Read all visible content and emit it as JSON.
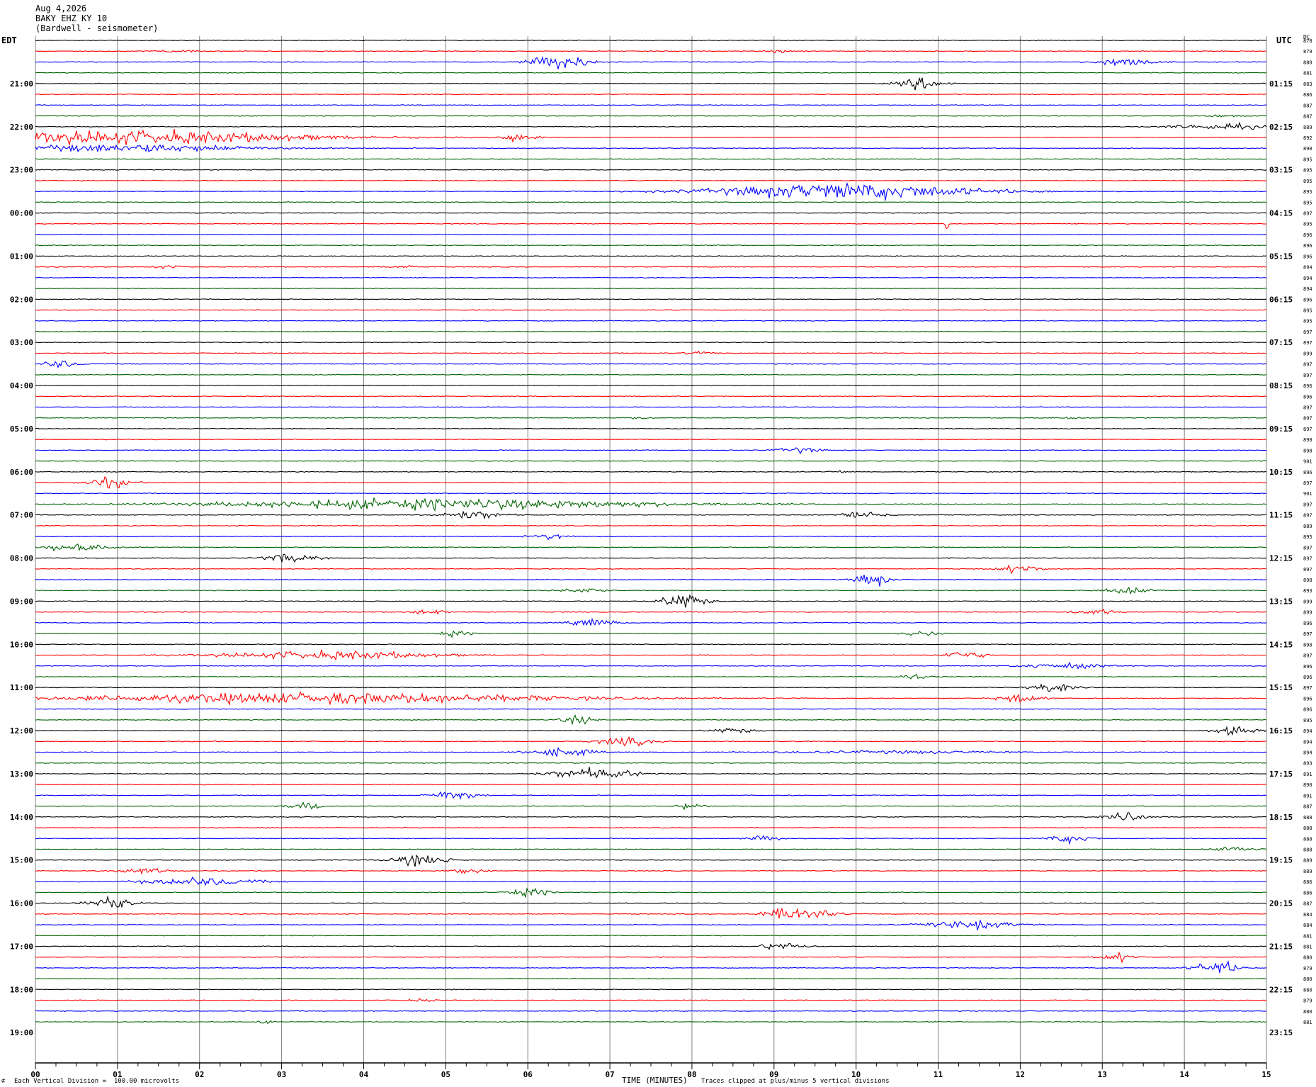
{
  "header": {
    "date": "Aug 4,2026",
    "station": "BAKY EHZ KY 10",
    "description": "(Bardwell - seismometer)"
  },
  "left_label": "EDT",
  "right_label": "UTC",
  "corner_label": "DC",
  "footer": {
    "scale_note": "Each Vertical Division =  100.00 microvolts",
    "clip_note": "Traces clipped at plus/minus 5 vertical divisions",
    "corner_mark": "⊄"
  },
  "colors": {
    "trace_cycle": [
      "#000000",
      "#ff0000",
      "#0000ff",
      "#006400"
    ],
    "gridline": "#808080",
    "background": "#ffffff"
  },
  "chart_data": {
    "type": "line",
    "title": "",
    "xlabel": "TIME (MINUTES)",
    "ylabel": "",
    "xlim": [
      0,
      15
    ],
    "x_ticks": [
      "00",
      "01",
      "02",
      "03",
      "04",
      "05",
      "06",
      "07",
      "08",
      "09",
      "10",
      "11",
      "12",
      "13",
      "14",
      "15"
    ],
    "minor_ticks_per_minute": 4,
    "grid": "vertical lines every minute",
    "trace_count": 92,
    "minutes_per_trace": 15,
    "left_hour_labels": [
      "21:00",
      "22:00",
      "23:00",
      "00:00",
      "01:00",
      "02:00",
      "03:00",
      "04:00",
      "05:00",
      "06:00",
      "07:00",
      "08:00",
      "09:00",
      "10:00",
      "11:00",
      "12:00",
      "13:00",
      "14:00",
      "15:00",
      "16:00",
      "17:00",
      "18:00",
      "19:00"
    ],
    "right_hour_labels": [
      "01:15",
      "02:15",
      "03:15",
      "04:15",
      "05:15",
      "06:15",
      "07:15",
      "08:15",
      "09:15",
      "10:15",
      "11:15",
      "12:15",
      "13:15",
      "14:15",
      "15:15",
      "16:15",
      "17:15",
      "18:15",
      "19:15",
      "20:15",
      "21:15",
      "22:15",
      "23:15"
    ],
    "first_hour_label_trace": 4,
    "dc_offsets": [
      878,
      879,
      880,
      881,
      883,
      886,
      887,
      887,
      889,
      892,
      898,
      895,
      895,
      895,
      895,
      895,
      897,
      895,
      896,
      896,
      896,
      894,
      894,
      894,
      896,
      895,
      895,
      897,
      897,
      899,
      897,
      897,
      896,
      896,
      897,
      897,
      897,
      898,
      898,
      901,
      896,
      897,
      901,
      897,
      897,
      889,
      895,
      897,
      897,
      897,
      898,
      893,
      899,
      899,
      896,
      897,
      898,
      897,
      896,
      896,
      897,
      896,
      896,
      895,
      894,
      894,
      894,
      893,
      891,
      890,
      891,
      887,
      888,
      888,
      888,
      888,
      889,
      889,
      886,
      886,
      887,
      884,
      884,
      881,
      881,
      880,
      879,
      880,
      880,
      879,
      880,
      881,
      878,
      878,
      877,
      875
    ],
    "events": [
      {
        "trace": 1,
        "minute": 1.7,
        "amplitude": 1,
        "duration": 0.4
      },
      {
        "trace": 1,
        "minute": 9.1,
        "amplitude": 1,
        "duration": 0.3
      },
      {
        "trace": 2,
        "minute": 6.4,
        "amplitude": 6,
        "duration": 0.5
      },
      {
        "trace": 2,
        "minute": 13.3,
        "amplitude": 3,
        "duration": 0.5
      },
      {
        "trace": 4,
        "minute": 10.8,
        "amplitude": 4,
        "duration": 0.4
      },
      {
        "trace": 7,
        "minute": 14.5,
        "amplitude": 1,
        "duration": 0.3
      },
      {
        "trace": 8,
        "minute": 14.5,
        "amplitude": 2,
        "duration": 1.0
      },
      {
        "trace": 9,
        "minute": 1.2,
        "amplitude": 5,
        "duration": 3.3
      },
      {
        "trace": 9,
        "minute": 5.9,
        "amplitude": 4,
        "duration": 0.3
      },
      {
        "trace": 10,
        "minute": 1.2,
        "amplitude": 3,
        "duration": 2.3
      },
      {
        "trace": 14,
        "minute": 9.9,
        "amplitude": 6,
        "duration": 2.4
      },
      {
        "trace": 17,
        "minute": 11.1,
        "amplitude": 7,
        "duration": 0.05
      },
      {
        "trace": 21,
        "minute": 1.6,
        "amplitude": 1,
        "duration": 0.3
      },
      {
        "trace": 21,
        "minute": 4.5,
        "amplitude": 1,
        "duration": 0.3
      },
      {
        "trace": 29,
        "minute": 8.1,
        "amplitude": 1,
        "duration": 0.3
      },
      {
        "trace": 30,
        "minute": 0.3,
        "amplitude": 3,
        "duration": 0.3
      },
      {
        "trace": 35,
        "minute": 7.4,
        "amplitude": 1,
        "duration": 0.2
      },
      {
        "trace": 35,
        "minute": 12.6,
        "amplitude": 1,
        "duration": 0.3
      },
      {
        "trace": 38,
        "minute": 9.3,
        "amplitude": 2,
        "duration": 0.4
      },
      {
        "trace": 40,
        "minute": 9.8,
        "amplitude": 1,
        "duration": 0.2
      },
      {
        "trace": 41,
        "minute": 0.9,
        "amplitude": 4,
        "duration": 0.4
      },
      {
        "trace": 43,
        "minute": 5.0,
        "amplitude": 4,
        "duration": 4.0
      },
      {
        "trace": 44,
        "minute": 5.3,
        "amplitude": 3,
        "duration": 0.6
      },
      {
        "trace": 44,
        "minute": 10.1,
        "amplitude": 3,
        "duration": 0.4
      },
      {
        "trace": 46,
        "minute": 6.3,
        "amplitude": 2,
        "duration": 0.4
      },
      {
        "trace": 47,
        "minute": 0.5,
        "amplitude": 3,
        "duration": 0.6
      },
      {
        "trace": 48,
        "minute": 3.1,
        "amplitude": 3,
        "duration": 0.5
      },
      {
        "trace": 49,
        "minute": 12.0,
        "amplitude": 3,
        "duration": 0.4
      },
      {
        "trace": 50,
        "minute": 10.2,
        "amplitude": 5,
        "duration": 0.3
      },
      {
        "trace": 51,
        "minute": 6.7,
        "amplitude": 2,
        "duration": 0.4
      },
      {
        "trace": 51,
        "minute": 13.3,
        "amplitude": 3,
        "duration": 0.4
      },
      {
        "trace": 52,
        "minute": 7.9,
        "amplitude": 6,
        "duration": 0.4
      },
      {
        "trace": 53,
        "minute": 4.8,
        "amplitude": 2,
        "duration": 0.3
      },
      {
        "trace": 53,
        "minute": 12.9,
        "amplitude": 2,
        "duration": 0.4
      },
      {
        "trace": 54,
        "minute": 6.8,
        "amplitude": 3,
        "duration": 0.4
      },
      {
        "trace": 55,
        "minute": 5.1,
        "amplitude": 2,
        "duration": 0.3
      },
      {
        "trace": 55,
        "minute": 10.8,
        "amplitude": 2,
        "duration": 0.3
      },
      {
        "trace": 57,
        "minute": 3.6,
        "amplitude": 3,
        "duration": 2.0
      },
      {
        "trace": 57,
        "minute": 11.3,
        "amplitude": 3,
        "duration": 0.4
      },
      {
        "trace": 58,
        "minute": 12.5,
        "amplitude": 2,
        "duration": 0.8
      },
      {
        "trace": 59,
        "minute": 10.7,
        "amplitude": 2,
        "duration": 0.3
      },
      {
        "trace": 60,
        "minute": 12.4,
        "amplitude": 3,
        "duration": 0.4
      },
      {
        "trace": 61,
        "minute": 3.5,
        "amplitude": 4,
        "duration": 4.5
      },
      {
        "trace": 61,
        "minute": 12.0,
        "amplitude": 3,
        "duration": 0.4
      },
      {
        "trace": 63,
        "minute": 6.6,
        "amplitude": 3,
        "duration": 0.3
      },
      {
        "trace": 64,
        "minute": 8.5,
        "amplitude": 2,
        "duration": 0.4
      },
      {
        "trace": 64,
        "minute": 14.6,
        "amplitude": 3,
        "duration": 0.4
      },
      {
        "trace": 65,
        "minute": 7.2,
        "amplitude": 3,
        "duration": 0.5
      },
      {
        "trace": 66,
        "minute": 6.4,
        "amplitude": 3,
        "duration": 0.6
      },
      {
        "trace": 66,
        "minute": 10.5,
        "amplitude": 1,
        "duration": 2.5
      },
      {
        "trace": 68,
        "minute": 6.8,
        "amplitude": 4,
        "duration": 0.8
      },
      {
        "trace": 70,
        "minute": 5.1,
        "amplitude": 4,
        "duration": 0.4
      },
      {
        "trace": 71,
        "minute": 3.3,
        "amplitude": 3,
        "duration": 0.3
      },
      {
        "trace": 71,
        "minute": 8.0,
        "amplitude": 2,
        "duration": 0.3
      },
      {
        "trace": 72,
        "minute": 13.3,
        "amplitude": 3,
        "duration": 0.4
      },
      {
        "trace": 74,
        "minute": 8.9,
        "amplitude": 2,
        "duration": 0.3
      },
      {
        "trace": 74,
        "minute": 12.6,
        "amplitude": 3,
        "duration": 0.4
      },
      {
        "trace": 75,
        "minute": 14.6,
        "amplitude": 2,
        "duration": 0.4
      },
      {
        "trace": 76,
        "minute": 4.7,
        "amplitude": 4,
        "duration": 0.5
      },
      {
        "trace": 77,
        "minute": 1.3,
        "amplitude": 2,
        "duration": 0.5
      },
      {
        "trace": 77,
        "minute": 5.3,
        "amplitude": 2,
        "duration": 0.3
      },
      {
        "trace": 78,
        "minute": 2.0,
        "amplitude": 3,
        "duration": 1.0
      },
      {
        "trace": 79,
        "minute": 6.0,
        "amplitude": 3,
        "duration": 0.4
      },
      {
        "trace": 80,
        "minute": 0.9,
        "amplitude": 5,
        "duration": 0.4
      },
      {
        "trace": 81,
        "minute": 9.3,
        "amplitude": 5,
        "duration": 0.6
      },
      {
        "trace": 82,
        "minute": 11.4,
        "amplitude": 3,
        "duration": 0.8
      },
      {
        "trace": 84,
        "minute": 9.1,
        "amplitude": 3,
        "duration": 0.4
      },
      {
        "trace": 85,
        "minute": 13.2,
        "amplitude": 3,
        "duration": 0.3
      },
      {
        "trace": 86,
        "minute": 14.4,
        "amplitude": 5,
        "duration": 0.4
      },
      {
        "trace": 89,
        "minute": 4.7,
        "amplitude": 1,
        "duration": 0.3
      },
      {
        "trace": 91,
        "minute": 2.8,
        "amplitude": 2,
        "duration": 0.1
      }
    ]
  }
}
